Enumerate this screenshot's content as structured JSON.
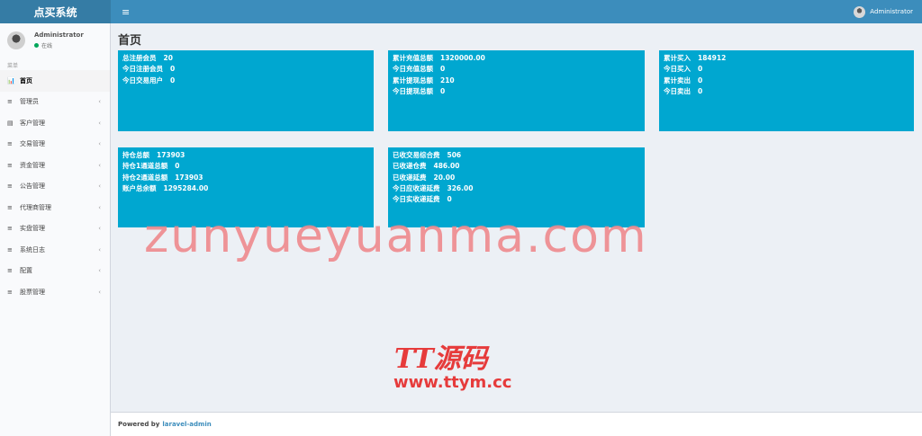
{
  "app": {
    "brand": "点买系统",
    "menu_toggle": "≡"
  },
  "user": {
    "name": "Administrator",
    "status": "在线"
  },
  "sidebar": {
    "header": "菜单",
    "items": [
      {
        "icon": "📊",
        "label": "首页",
        "active": true,
        "chevron": ""
      },
      {
        "icon": "≡",
        "label": "管理员",
        "chevron": "‹"
      },
      {
        "icon": "▤",
        "label": "客户管理",
        "chevron": "‹"
      },
      {
        "icon": "≡",
        "label": "交易管理",
        "chevron": "‹"
      },
      {
        "icon": "≡",
        "label": "资金管理",
        "chevron": "‹"
      },
      {
        "icon": "≡",
        "label": "公告管理",
        "chevron": "‹"
      },
      {
        "icon": "≡",
        "label": "代理商管理",
        "chevron": "‹"
      },
      {
        "icon": "≡",
        "label": "实盘管理",
        "chevron": "‹"
      },
      {
        "icon": "≡",
        "label": "系统日志",
        "chevron": "‹"
      },
      {
        "icon": "≡",
        "label": "配置",
        "chevron": "‹"
      },
      {
        "icon": "≡",
        "label": "股票管理",
        "chevron": "‹"
      }
    ]
  },
  "page": {
    "title": "首页"
  },
  "boxes": [
    {
      "rows": [
        {
          "label": "总注册会员",
          "value": "20"
        },
        {
          "label": "今日注册会员",
          "value": "0"
        },
        {
          "label": "今日交易用户",
          "value": "0"
        }
      ]
    },
    {
      "rows": [
        {
          "label": "累计充值总额",
          "value": "1320000.00"
        },
        {
          "label": "今日充值总额",
          "value": "0"
        },
        {
          "label": "累计提现总额",
          "value": "210"
        },
        {
          "label": "今日提现总额",
          "value": "0"
        }
      ]
    },
    {
      "rows": [
        {
          "label": "累计买入",
          "value": "184912"
        },
        {
          "label": "今日买入",
          "value": "0"
        },
        {
          "label": "累计卖出",
          "value": "0"
        },
        {
          "label": "今日卖出",
          "value": "0"
        }
      ]
    },
    {
      "rows": [
        {
          "label": "持仓总额",
          "value": "173903"
        },
        {
          "label": "持仓1通道总额",
          "value": "0"
        },
        {
          "label": "持仓2通道总额",
          "value": "173903"
        },
        {
          "label": "账户总余额",
          "value": "1295284.00"
        }
      ]
    },
    {
      "rows": [
        {
          "label": "已收交易综合费",
          "value": "506"
        },
        {
          "label": "已收递仓费",
          "value": "486.00"
        },
        {
          "label": "已收递延费",
          "value": "20.00"
        },
        {
          "label": "今日应收递延费",
          "value": "326.00"
        },
        {
          "label": "今日实收递延费",
          "value": "0"
        }
      ]
    }
  ],
  "watermarks": {
    "site": "zunyueyuanma.com",
    "brand": "TT源码",
    "url": "www.ttym.cc"
  },
  "footer": {
    "prefix": "Powered by",
    "link": "laravel-admin"
  },
  "colors": {
    "navbar": "#3c8dbc",
    "brand_bg": "#357ca5",
    "box": "#00a7d0",
    "status_online": "#00a65a"
  }
}
